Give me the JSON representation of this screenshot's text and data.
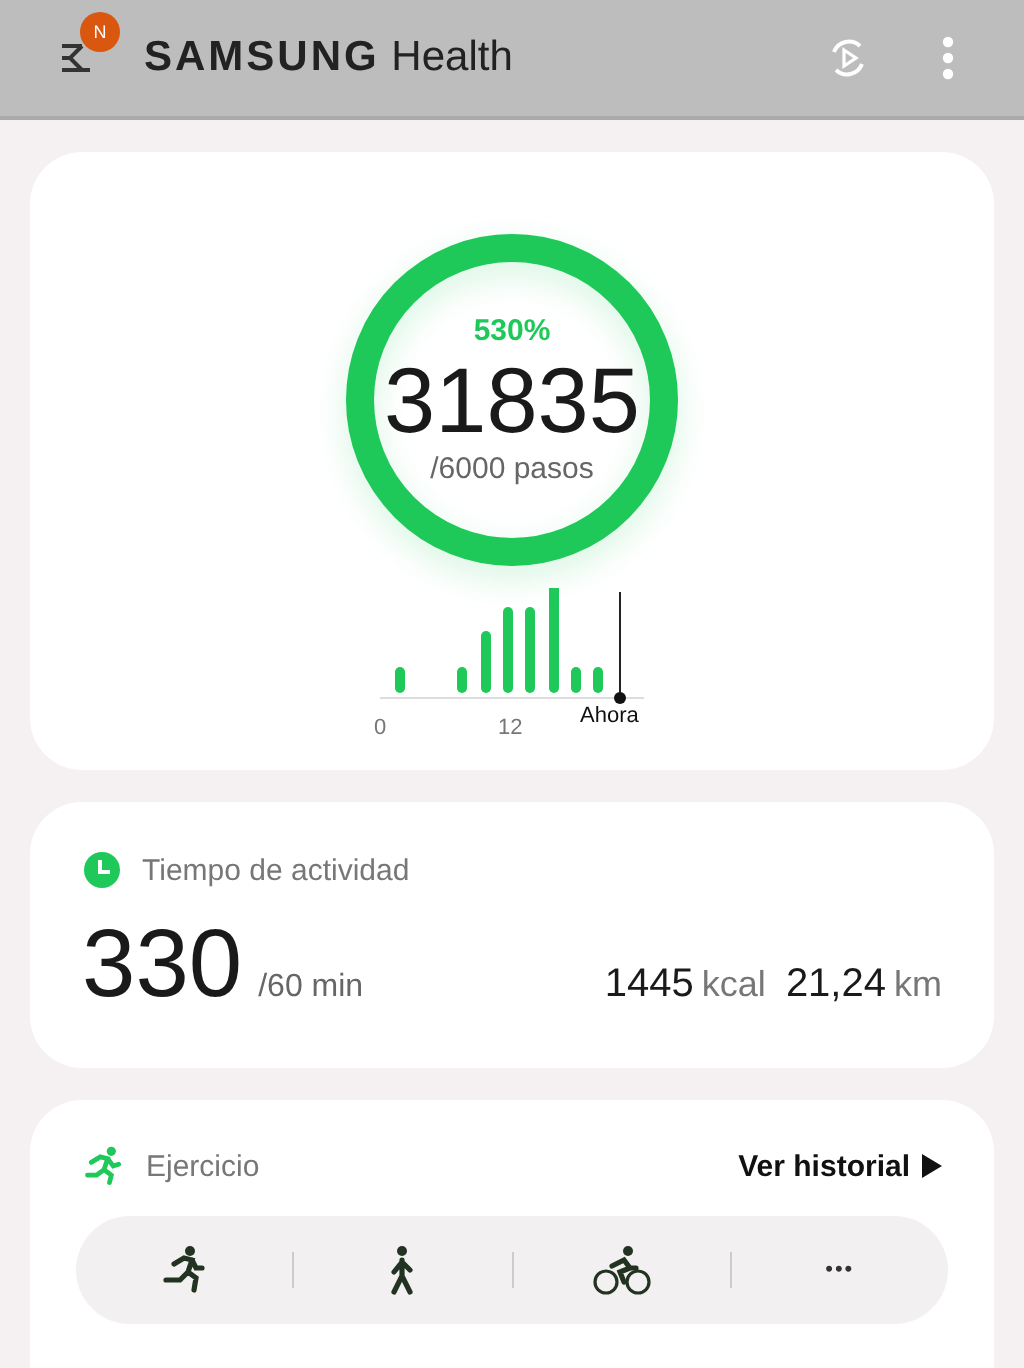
{
  "app_bar": {
    "badge": "N",
    "title_brand": "SAMSUNG",
    "title_app": "Health"
  },
  "steps": {
    "percent": "530%",
    "count": "31835",
    "goal": "/6000 pasos",
    "level": 1,
    "axis_labels": [
      "0",
      "12"
    ],
    "now_label": "Ahora"
  },
  "activity": {
    "title": "Tiempo de actividad",
    "minutes": "330",
    "minutes_goal": "/60 min",
    "calories": "1445",
    "calories_unit": "kcal",
    "distance": "21,24",
    "distance_unit": "km"
  },
  "exercise": {
    "title": "Ejercicio",
    "history_link": "Ver historial",
    "more": "•••"
  }
}
